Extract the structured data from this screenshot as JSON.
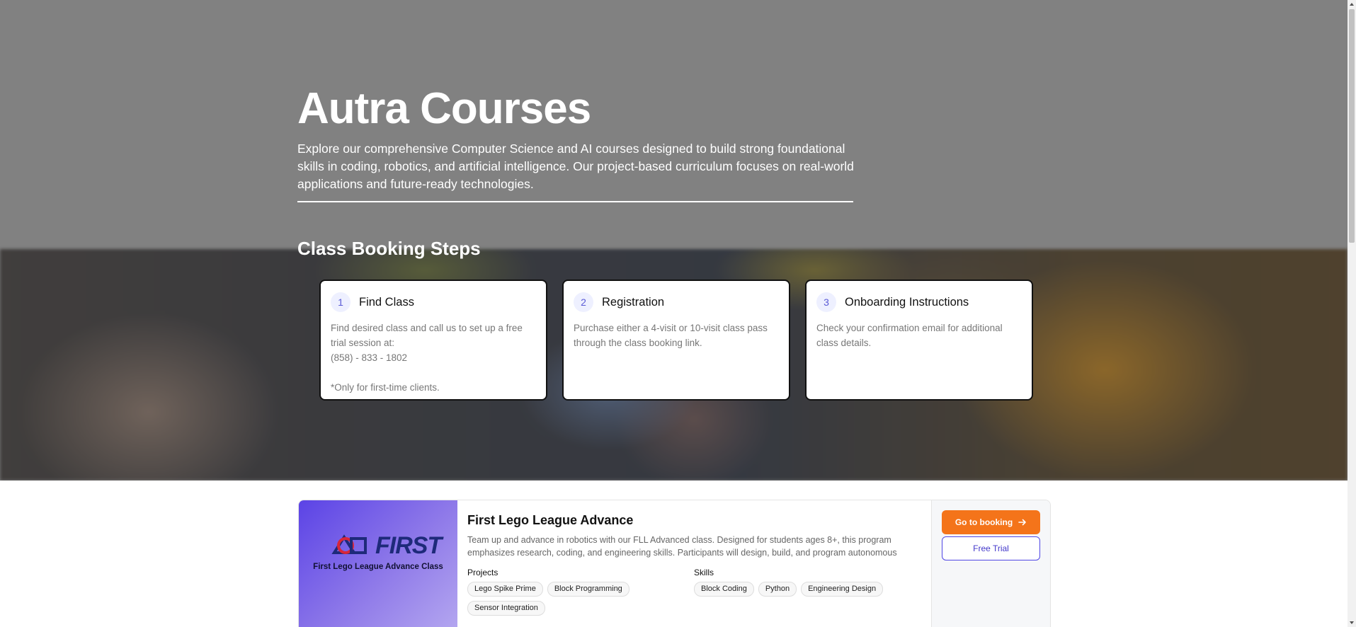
{
  "hero": {
    "title": "Autra Courses",
    "description": "Explore our comprehensive Computer Science and AI courses designed to build strong foundational skills in coding, robotics, and artificial intelligence. Our project-based curriculum focuses on real-world applications and future-ready technologies."
  },
  "booking": {
    "title": "Class Booking Steps",
    "steps": [
      {
        "number": "1",
        "title": "Find Class",
        "text_1": "Find desired class and call us to set up a free trial session at:",
        "phone": "(858) - 833 - 1802",
        "note": "*Only for first-time clients."
      },
      {
        "number": "2",
        "title": "Registration",
        "text_1": "Purchase either a 4-visit or 10-visit class pass through the class booking link."
      },
      {
        "number": "3",
        "title": "Onboarding Instructions",
        "text_1": "Check your confirmation email for additional class details."
      }
    ]
  },
  "course": {
    "image_logo_text": "FIRST",
    "image_caption": "First Lego League Advance Class",
    "title": "First Lego League Advance",
    "description": "Team up and advance in robotics with our FLL Advanced class. Designed for students ages 8+, this program emphasizes research, coding, and engineering skills. Participants will design, build, and program autonomous LEGO®...",
    "projects_label": "Projects",
    "projects": [
      "Lego Spike Prime",
      "Block Programming",
      "Sensor Integration"
    ],
    "skills_label": "Skills",
    "skills": [
      "Block Coding",
      "Python",
      "Engineering Design"
    ],
    "book_label": "Go to booking",
    "trial_label": "Free Trial"
  },
  "colors": {
    "accent_orange": "#f4741a",
    "accent_indigo": "#4f46e5",
    "hero_gray": "#818181"
  }
}
